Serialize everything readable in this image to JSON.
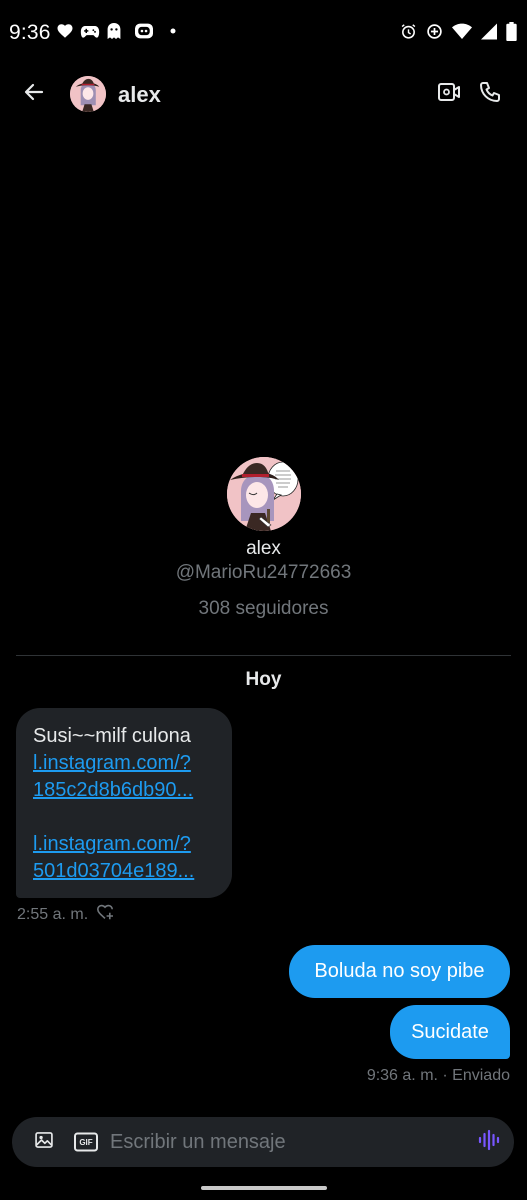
{
  "status_bar": {
    "time": "9:36",
    "notification_icons": [
      "heart-icon",
      "game-controller-icon",
      "ghost-icon",
      "discord-icon",
      "dot-icon"
    ],
    "system_icons": [
      "alarm-icon",
      "data-saver-icon",
      "wifi-icon",
      "signal-icon",
      "battery-icon"
    ]
  },
  "header": {
    "title": "alex",
    "back_icon": "arrow-left-icon",
    "video_icon": "video-call-icon",
    "call_icon": "phone-icon"
  },
  "profile": {
    "name": "alex",
    "handle": "@MarioRu24772663",
    "followers": "308 seguidores"
  },
  "conversation": {
    "date_label": "Hoy",
    "received": {
      "text": "Susi~~milf culona",
      "link1_line1": "l.instagram.com/?",
      "link1_line2": "185c2d8b6db90...",
      "link2_line1": "l.instagram.com/?",
      "link2_line2": "501d03704e189...",
      "time": "2:55 a. m."
    },
    "sent": [
      {
        "text": "Boluda no soy pibe"
      },
      {
        "text": "Sucidate"
      }
    ],
    "sent_meta": "9:36 a. m. · Enviado"
  },
  "composer": {
    "placeholder": "Escribir un mensaje",
    "gif_label": "GIF"
  },
  "colors": {
    "background": "#000000",
    "accent": "#1d9bf0",
    "bubble_received": "#202327",
    "muted_text": "#71767b",
    "voice_icon": "#7856ff"
  }
}
